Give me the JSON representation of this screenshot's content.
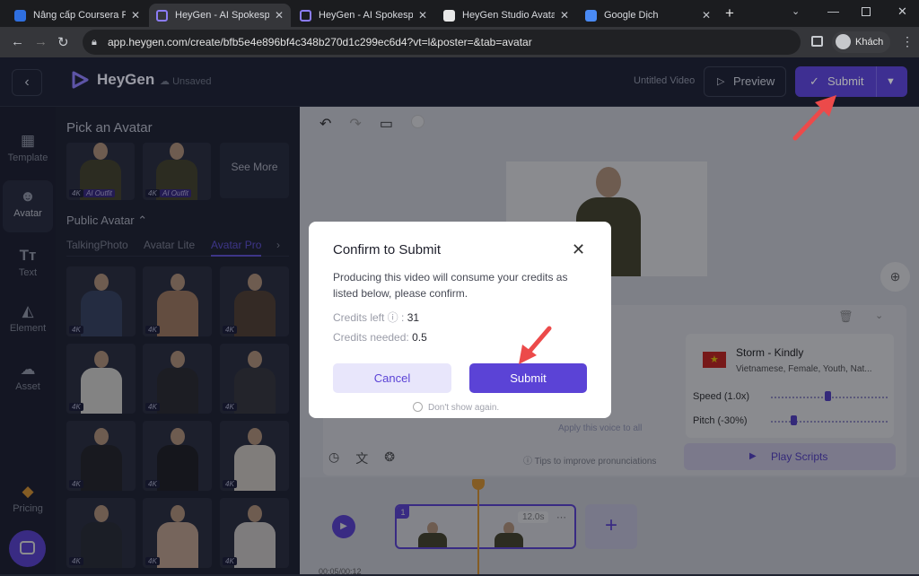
{
  "browser": {
    "tabs": [
      {
        "title": "Nâng cấp Coursera Plus",
        "active": false
      },
      {
        "title": "HeyGen - AI Spokesper",
        "active": true
      },
      {
        "title": "HeyGen - AI Spokesper",
        "active": false
      },
      {
        "title": "HeyGen Studio Avatar",
        "active": false
      },
      {
        "title": "Google Dịch",
        "active": false
      }
    ],
    "url": "app.heygen.com/create/bfb5e4e896bf4c348b270d1c299ec6d4?vt=l&poster=&tab=avatar",
    "profile": "Khách"
  },
  "header": {
    "brand": "HeyGen",
    "save_status": "Unsaved",
    "video_title": "Untitled Video",
    "preview_label": "Preview",
    "submit_label": "Submit"
  },
  "rail": {
    "items": [
      {
        "label": "Template",
        "icon": "template-icon"
      },
      {
        "label": "Avatar",
        "icon": "avatar-icon"
      },
      {
        "label": "Text",
        "icon": "text-icon"
      },
      {
        "label": "Element",
        "icon": "element-icon"
      },
      {
        "label": "Asset",
        "icon": "asset-icon"
      },
      {
        "label": "Pricing",
        "icon": "pricing-icon"
      }
    ]
  },
  "avatar_panel": {
    "title": "Pick an Avatar",
    "see_more": "See More",
    "badge_4k": "4K",
    "badge_outfit": "AI Outfit",
    "public_heading": "Public Avatar",
    "tabs": [
      "TalkingPhoto",
      "Avatar Lite",
      "Avatar Pro"
    ],
    "active_tab": "Avatar Pro"
  },
  "voice": {
    "name": "Storm - Kindly",
    "meta": "Vietnamese, Female, Youth, Nat...",
    "speed_label": "Speed (1.0x)",
    "pitch_label": "Pitch (-30%)",
    "speed_value": 1.0,
    "pitch_value": -30,
    "apply_label": "Apply this voice to all",
    "play_scripts": "Play Scripts",
    "tips": "Tips to improve pronunciations"
  },
  "timeline": {
    "clip_number": "1",
    "clip_duration": "12.0s",
    "time": "00:05/00:12"
  },
  "modal": {
    "title": "Confirm to Submit",
    "description": "Producing this video will consume your credits as listed below, please confirm.",
    "credits_left_label": "Credits left ⓘ :",
    "credits_left_value": "31",
    "credits_needed_label": "Credits needed:",
    "credits_needed_value": "0.5",
    "cancel_label": "Cancel",
    "submit_label": "Submit",
    "dont_show": "Don't show again."
  },
  "colors": {
    "accent": "#5b43d6",
    "annotation_arrow": "#ec4a4a"
  }
}
